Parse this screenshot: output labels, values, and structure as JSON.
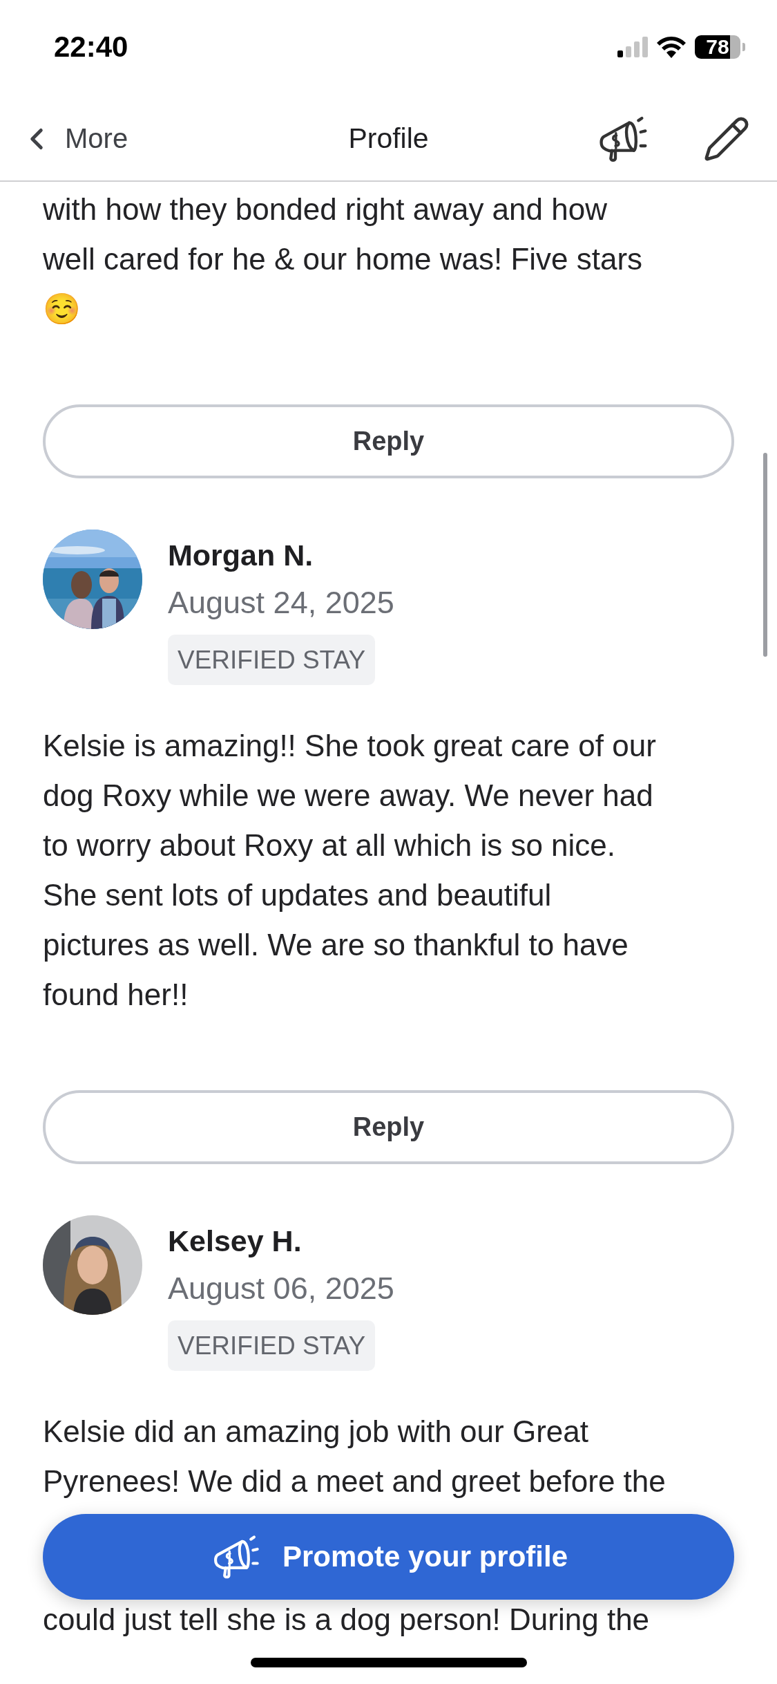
{
  "status_bar": {
    "time": "22:40",
    "battery": "78"
  },
  "nav": {
    "back_label": "More",
    "title": "Profile"
  },
  "previous_review": {
    "text": "with how they bonded right away and how\nwell cared for he & our home was! Five stars\n☺️",
    "reply_label": "Reply"
  },
  "reviews": [
    {
      "name": "Morgan N.",
      "date": "August 24, 2025",
      "badge": "VERIFIED STAY",
      "text": "Kelsie is amazing!! She took great care of our\ndog Roxy while we were away. We never had\nto worry about Roxy at all which is so nice.\nShe sent lots of updates and beautiful\npictures as well. We are so thankful to have\nfound her!!",
      "reply_label": "Reply"
    },
    {
      "name": "Kelsey H.",
      "date": "August 06, 2025",
      "badge": "VERIFIED STAY",
      "text": "Kelsie did an amazing job with our Great\nPyrenees! We did a meet and greet before the",
      "text_continued": "could just tell she is a dog person! During the"
    }
  ],
  "promote_button": {
    "label": "Promote your profile"
  }
}
